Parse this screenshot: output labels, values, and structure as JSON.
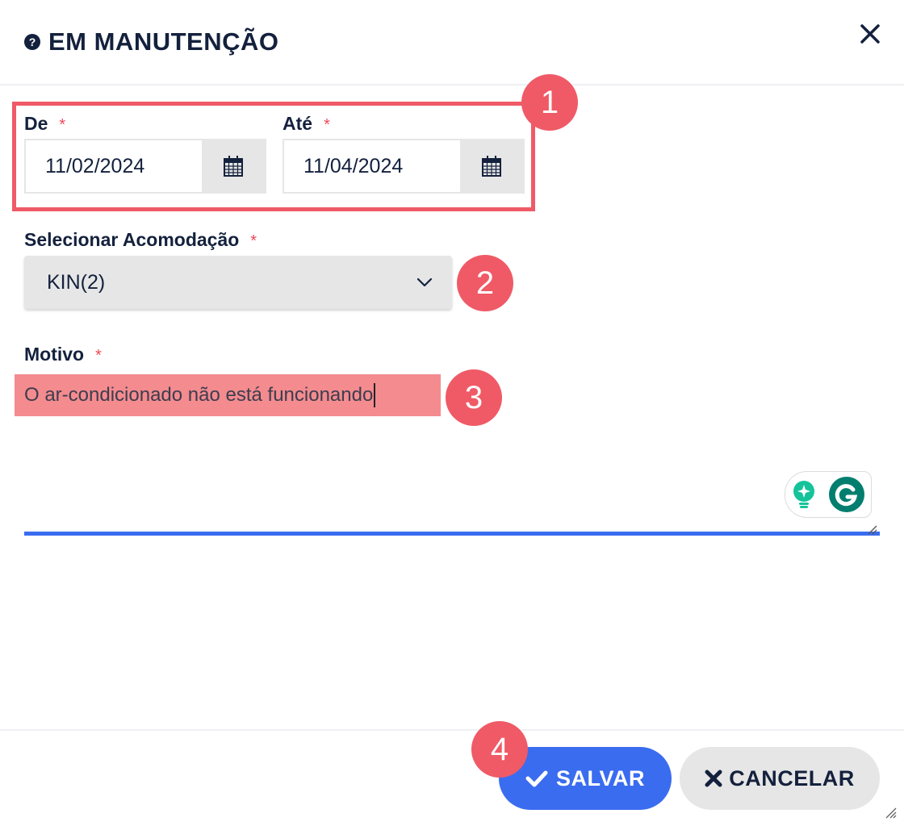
{
  "header": {
    "title": "EM MANUTENÇÃO",
    "help_icon": "question-circle-icon",
    "close_icon": "close-icon"
  },
  "dates": {
    "from": {
      "label": "De",
      "required_mark": "*",
      "value": "11/02/2024",
      "icon": "calendar-icon"
    },
    "to": {
      "label": "Até",
      "required_mark": "*",
      "value": "11/04/2024",
      "icon": "calendar-icon"
    }
  },
  "accommodation": {
    "label": "Selecionar Acomodação",
    "required_mark": "*",
    "value": "KIN(2)",
    "icon": "chevron-down-icon"
  },
  "reason": {
    "label": "Motivo",
    "required_mark": "*",
    "value": "O ar-condicionado não está funcionando"
  },
  "grammarly": {
    "icons": [
      "lightbulb-icon",
      "grammarly-g-icon"
    ]
  },
  "steps": [
    "1",
    "2",
    "3",
    "4"
  ],
  "footer": {
    "save_label": "SALVAR",
    "cancel_label": "CANCELAR"
  },
  "colors": {
    "primary": "#3a6cf0",
    "annotation": "#ef5a66",
    "text": "#14213d",
    "button_gray": "#e6e6e6",
    "grammarly_green": "#15c39a",
    "grammarly_dark": "#027e6f"
  }
}
